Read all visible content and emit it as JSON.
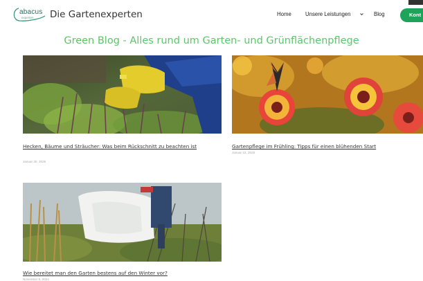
{
  "header": {
    "logo_text": "abacus",
    "logo_sub": "experten",
    "brand": "Die Gartenexperten",
    "nav": {
      "home": "Home",
      "leistungen": "Unsere Leistungen",
      "blog": "Blog"
    },
    "cta": "Kont"
  },
  "page_title": "Green Blog - Alles rund um Garten- und Grünflächenpflege",
  "posts": [
    {
      "title": "Hecken, Bäume und Sträucher: Was beim Rückschnitt zu beachten ist",
      "date": "Januar 30, 2025"
    },
    {
      "title": "Gartenpflege im Frühling: Tipps für einen blühenden Start",
      "date": "Januar 23, 2025"
    },
    {
      "title": "Wie bereitet man den Garten bestens auf den Winter vor?",
      "date": "November 9, 2024"
    }
  ],
  "colors": {
    "accent": "#1ea35a",
    "title": "#5cc66a",
    "logo": "#2f6b59"
  }
}
